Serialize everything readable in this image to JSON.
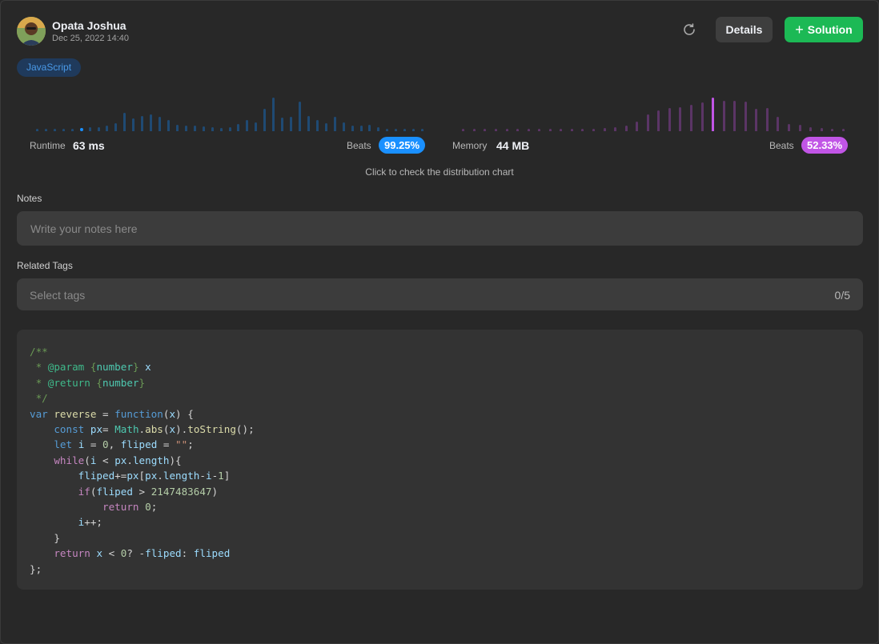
{
  "header": {
    "author": "Opata Joshua",
    "date": "Dec 25, 2022 14:40",
    "details_label": "Details",
    "solution_label": "Solution"
  },
  "language": "JavaScript",
  "runtime": {
    "label": "Runtime",
    "value": "63 ms",
    "beats_label": "Beats",
    "beats": "99.25%",
    "color": "#1a90ff",
    "distribution": [
      0.05,
      0.05,
      0.05,
      0.05,
      0.05,
      0.08,
      0.1,
      0.1,
      0.14,
      0.2,
      0.44,
      0.3,
      0.36,
      0.4,
      0.34,
      0.26,
      0.16,
      0.13,
      0.14,
      0.12,
      0.09,
      0.08,
      0.1,
      0.18,
      0.26,
      0.22,
      0.54,
      0.8,
      0.32,
      0.34,
      0.72,
      0.36,
      0.26,
      0.2,
      0.34,
      0.22,
      0.13,
      0.14,
      0.16,
      0.1,
      0.05,
      0.05,
      0.05,
      0.05,
      0.05
    ],
    "highlight_index": 5
  },
  "memory": {
    "label": "Memory",
    "value": "44 MB",
    "beats_label": "Beats",
    "beats": "52.33%",
    "color": "#c155e6",
    "distribution": [
      0.05,
      0.05,
      0.05,
      0.05,
      0.05,
      0.05,
      0.05,
      0.05,
      0.05,
      0.05,
      0.05,
      0.05,
      0.05,
      0.08,
      0.1,
      0.14,
      0.24,
      0.4,
      0.5,
      0.56,
      0.58,
      0.64,
      0.7,
      0.8,
      0.74,
      0.74,
      0.72,
      0.54,
      0.56,
      0.34,
      0.18,
      0.16,
      0.1,
      0.07,
      0.05,
      0.05
    ],
    "highlight_index": 23
  },
  "distribution_hint": "Click to check the distribution chart",
  "notes": {
    "label": "Notes",
    "placeholder": "Write your notes here"
  },
  "tags": {
    "label": "Related Tags",
    "placeholder": "Select tags",
    "count": "0/5"
  }
}
